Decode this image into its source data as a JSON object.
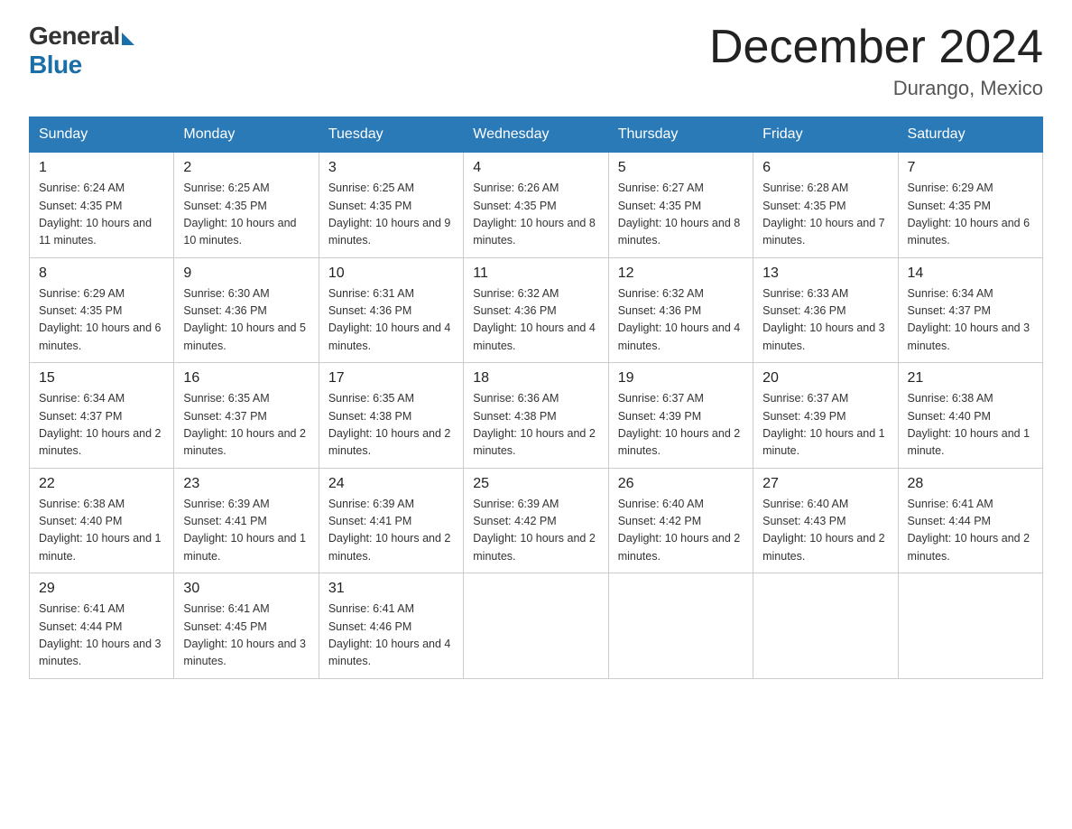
{
  "logo": {
    "general": "General",
    "blue": "Blue"
  },
  "title": "December 2024",
  "location": "Durango, Mexico",
  "days_of_week": [
    "Sunday",
    "Monday",
    "Tuesday",
    "Wednesday",
    "Thursday",
    "Friday",
    "Saturday"
  ],
  "weeks": [
    [
      {
        "day": "1",
        "sunrise": "6:24 AM",
        "sunset": "4:35 PM",
        "daylight": "10 hours and 11 minutes."
      },
      {
        "day": "2",
        "sunrise": "6:25 AM",
        "sunset": "4:35 PM",
        "daylight": "10 hours and 10 minutes."
      },
      {
        "day": "3",
        "sunrise": "6:25 AM",
        "sunset": "4:35 PM",
        "daylight": "10 hours and 9 minutes."
      },
      {
        "day": "4",
        "sunrise": "6:26 AM",
        "sunset": "4:35 PM",
        "daylight": "10 hours and 8 minutes."
      },
      {
        "day": "5",
        "sunrise": "6:27 AM",
        "sunset": "4:35 PM",
        "daylight": "10 hours and 8 minutes."
      },
      {
        "day": "6",
        "sunrise": "6:28 AM",
        "sunset": "4:35 PM",
        "daylight": "10 hours and 7 minutes."
      },
      {
        "day": "7",
        "sunrise": "6:29 AM",
        "sunset": "4:35 PM",
        "daylight": "10 hours and 6 minutes."
      }
    ],
    [
      {
        "day": "8",
        "sunrise": "6:29 AM",
        "sunset": "4:35 PM",
        "daylight": "10 hours and 6 minutes."
      },
      {
        "day": "9",
        "sunrise": "6:30 AM",
        "sunset": "4:36 PM",
        "daylight": "10 hours and 5 minutes."
      },
      {
        "day": "10",
        "sunrise": "6:31 AM",
        "sunset": "4:36 PM",
        "daylight": "10 hours and 4 minutes."
      },
      {
        "day": "11",
        "sunrise": "6:32 AM",
        "sunset": "4:36 PM",
        "daylight": "10 hours and 4 minutes."
      },
      {
        "day": "12",
        "sunrise": "6:32 AM",
        "sunset": "4:36 PM",
        "daylight": "10 hours and 4 minutes."
      },
      {
        "day": "13",
        "sunrise": "6:33 AM",
        "sunset": "4:36 PM",
        "daylight": "10 hours and 3 minutes."
      },
      {
        "day": "14",
        "sunrise": "6:34 AM",
        "sunset": "4:37 PM",
        "daylight": "10 hours and 3 minutes."
      }
    ],
    [
      {
        "day": "15",
        "sunrise": "6:34 AM",
        "sunset": "4:37 PM",
        "daylight": "10 hours and 2 minutes."
      },
      {
        "day": "16",
        "sunrise": "6:35 AM",
        "sunset": "4:37 PM",
        "daylight": "10 hours and 2 minutes."
      },
      {
        "day": "17",
        "sunrise": "6:35 AM",
        "sunset": "4:38 PM",
        "daylight": "10 hours and 2 minutes."
      },
      {
        "day": "18",
        "sunrise": "6:36 AM",
        "sunset": "4:38 PM",
        "daylight": "10 hours and 2 minutes."
      },
      {
        "day": "19",
        "sunrise": "6:37 AM",
        "sunset": "4:39 PM",
        "daylight": "10 hours and 2 minutes."
      },
      {
        "day": "20",
        "sunrise": "6:37 AM",
        "sunset": "4:39 PM",
        "daylight": "10 hours and 1 minute."
      },
      {
        "day": "21",
        "sunrise": "6:38 AM",
        "sunset": "4:40 PM",
        "daylight": "10 hours and 1 minute."
      }
    ],
    [
      {
        "day": "22",
        "sunrise": "6:38 AM",
        "sunset": "4:40 PM",
        "daylight": "10 hours and 1 minute."
      },
      {
        "day": "23",
        "sunrise": "6:39 AM",
        "sunset": "4:41 PM",
        "daylight": "10 hours and 1 minute."
      },
      {
        "day": "24",
        "sunrise": "6:39 AM",
        "sunset": "4:41 PM",
        "daylight": "10 hours and 2 minutes."
      },
      {
        "day": "25",
        "sunrise": "6:39 AM",
        "sunset": "4:42 PM",
        "daylight": "10 hours and 2 minutes."
      },
      {
        "day": "26",
        "sunrise": "6:40 AM",
        "sunset": "4:42 PM",
        "daylight": "10 hours and 2 minutes."
      },
      {
        "day": "27",
        "sunrise": "6:40 AM",
        "sunset": "4:43 PM",
        "daylight": "10 hours and 2 minutes."
      },
      {
        "day": "28",
        "sunrise": "6:41 AM",
        "sunset": "4:44 PM",
        "daylight": "10 hours and 2 minutes."
      }
    ],
    [
      {
        "day": "29",
        "sunrise": "6:41 AM",
        "sunset": "4:44 PM",
        "daylight": "10 hours and 3 minutes."
      },
      {
        "day": "30",
        "sunrise": "6:41 AM",
        "sunset": "4:45 PM",
        "daylight": "10 hours and 3 minutes."
      },
      {
        "day": "31",
        "sunrise": "6:41 AM",
        "sunset": "4:46 PM",
        "daylight": "10 hours and 4 minutes."
      },
      null,
      null,
      null,
      null
    ]
  ]
}
